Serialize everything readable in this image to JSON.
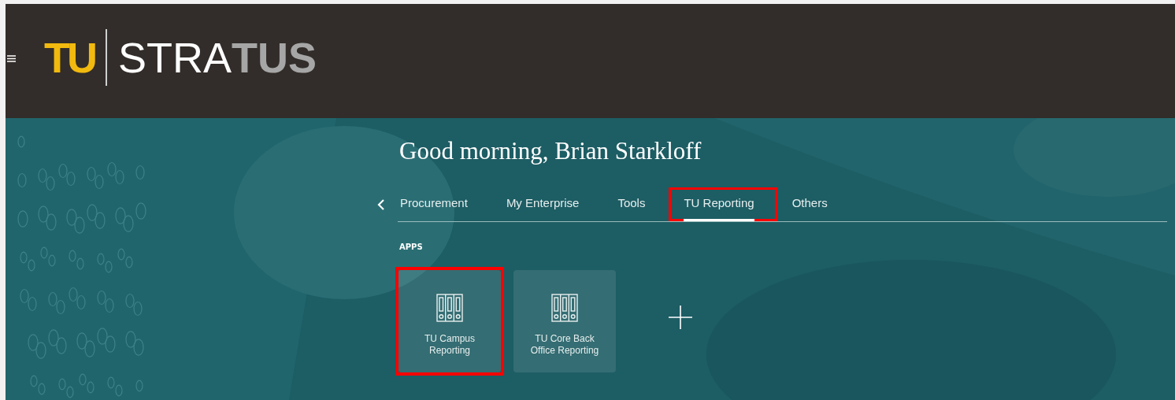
{
  "header": {
    "logo": {
      "mark": "TU",
      "name_light": "STRA",
      "name_dark": "TUS"
    }
  },
  "greeting": "Good morning, Brian Starkloff",
  "tabs": [
    {
      "label": "Procurement",
      "selected": false,
      "highlighted": false
    },
    {
      "label": "My Enterprise",
      "selected": false,
      "highlighted": false
    },
    {
      "label": "Tools",
      "selected": false,
      "highlighted": false
    },
    {
      "label": "TU Reporting",
      "selected": true,
      "highlighted": true
    },
    {
      "label": "Others",
      "selected": false,
      "highlighted": false
    }
  ],
  "apps_heading": "APPS",
  "apps": [
    {
      "label": "TU Campus Reporting",
      "highlighted": true
    },
    {
      "label": "TU Core Back Office Reporting",
      "highlighted": false
    }
  ]
}
